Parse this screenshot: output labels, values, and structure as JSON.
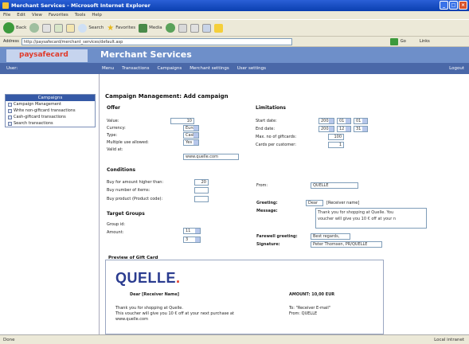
{
  "window": {
    "title": "Merchant Services - Microsoft Internet Explorer",
    "controls": [
      "_",
      "□",
      "×"
    ]
  },
  "menubar": [
    "File",
    "Edit",
    "View",
    "Favorites",
    "Tools",
    "Help"
  ],
  "toolbar": {
    "back": "Back",
    "search": "Search",
    "favorites": "Favorites",
    "media": "Media"
  },
  "address": {
    "label": "Address",
    "value": "http://paysafecard/merchant_services/default.asp",
    "go": "Go",
    "links": "Links"
  },
  "site": {
    "logo": "paysafecard",
    "title": "Merchant Services",
    "user": "User:",
    "nav": [
      "Menu",
      "Transactions",
      "Campaigns",
      "Merchant settings",
      "User settings"
    ],
    "logout": "Logout"
  },
  "sidebar": {
    "header": "Campaigns",
    "items": [
      "Campaign Management",
      "Write non-giftcard transactions",
      "Cash-giftcard transactions",
      "Search transactions"
    ]
  },
  "main": {
    "page_title": "Campaign Management: Add campaign",
    "offer": {
      "title": "Offer",
      "value_label": "Value:",
      "value": "10",
      "currency_label": "Currency:",
      "currency": "Euro",
      "type_label": "Type:",
      "type": "Cash",
      "multiple_label": "Multiple use allowed:",
      "multiple": "Yes",
      "valid_label": "Valid at:",
      "valid": "www.quelle.com"
    },
    "limitations": {
      "title": "Limitations",
      "start_label": "Start date:",
      "start": [
        "2003",
        "01",
        "01"
      ],
      "end_label": "End date:",
      "end": [
        "2003",
        "12",
        "31"
      ],
      "max_label": "Max. no of giftcards:",
      "max": "100",
      "per_customer_label": "Cards per customer:",
      "per_customer": "1"
    },
    "conditions": {
      "title": "Conditions",
      "amount_label": "Buy for amount higher than:",
      "amount": "20",
      "items_label": "Buy number of items:",
      "items": "",
      "product_label": "Buy product (Product code):",
      "product": ""
    },
    "from": {
      "label": "From:",
      "value": "QUELLE"
    },
    "target": {
      "title": "Target Groups",
      "group_label": "Group id:",
      "group": "11",
      "amount_label": "Amount:",
      "amount": "3"
    },
    "greeting": {
      "label": "Greeting:",
      "value": "Dear",
      "suffix": "[Receiver name]",
      "message_label": "Message:",
      "message_lines": [
        "Thank you for shopping at Quelle. You",
        "voucher will give you 10 € off at your n"
      ],
      "farewell_label": "Farewell greeting:",
      "farewell": "Best regards,",
      "signature_label": "Signature:",
      "signature": "Peter Thomsen, PR/QUELLE"
    },
    "preview": {
      "title": "Preview of Gift Card",
      "brand": "QUELLE",
      "dear": "Dear [Receiver Name]",
      "amount": "AMOUNT: 10,00 EUR",
      "body_lines": [
        "Thank you for shopping at Quelle.",
        "This voucher will give you 10 € off at your next purchase at",
        "www.quelle.com"
      ],
      "to": "To: \"Receiver E-mail\"",
      "from": "From: QUELLE"
    }
  },
  "statusbar": {
    "left": "Done",
    "right": "Local intranet"
  }
}
